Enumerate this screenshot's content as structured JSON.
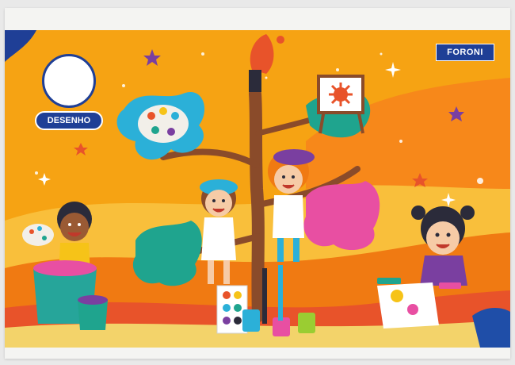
{
  "cover": {
    "brand": "FORONI",
    "label": "DESENHO"
  },
  "colors": {
    "background": "#f6a313",
    "accent_blue": "#1f3f96",
    "ground": "#f07a12"
  },
  "illustrations": [
    "tree-icon",
    "child-icon",
    "palette-icon",
    "paintbrush-icon",
    "easel-icon",
    "paint-bucket-icon",
    "star-icon"
  ]
}
